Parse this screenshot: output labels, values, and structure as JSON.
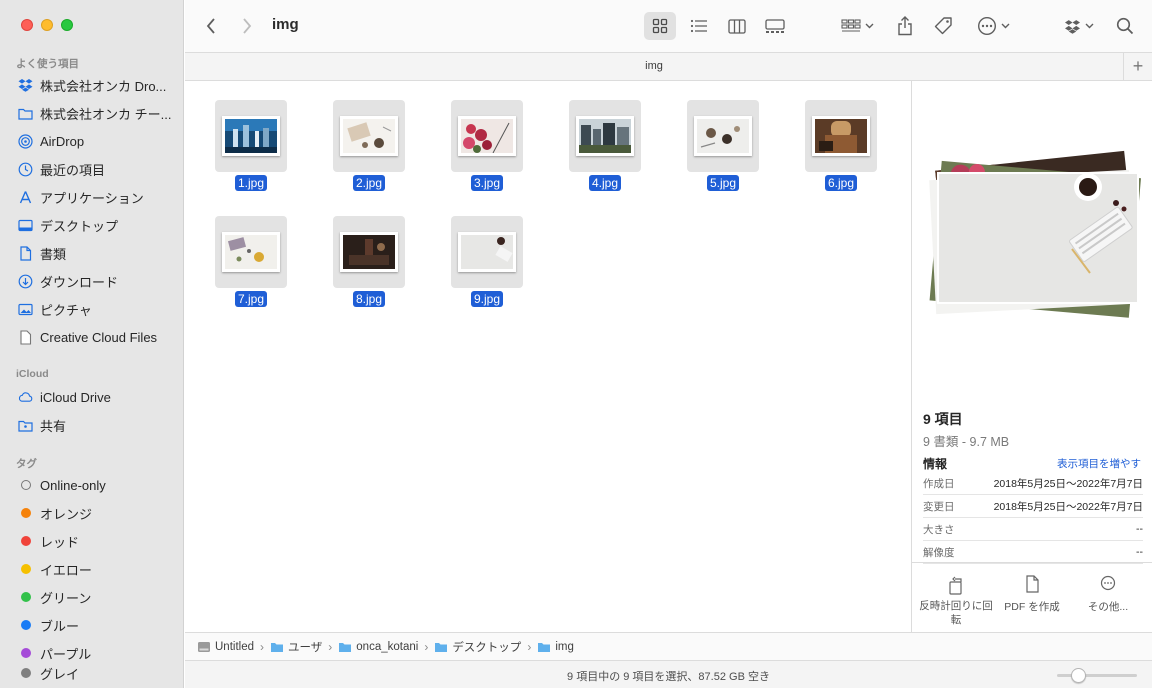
{
  "window": {
    "title": "img"
  },
  "sidebar": {
    "favorites_heading": "よく使う項目",
    "favorites": [
      {
        "label": "株式会社オンカ Dro...",
        "icon": "dropbox-icon"
      },
      {
        "label": "株式会社オンカ チー...",
        "icon": "folder-icon"
      },
      {
        "label": "AirDrop",
        "icon": "airdrop-icon"
      },
      {
        "label": "最近の項目",
        "icon": "clock-icon"
      },
      {
        "label": "アプリケーション",
        "icon": "applications-icon"
      },
      {
        "label": "デスクトップ",
        "icon": "desktop-icon"
      },
      {
        "label": "書類",
        "icon": "document-icon"
      },
      {
        "label": "ダウンロード",
        "icon": "download-icon"
      },
      {
        "label": "ピクチャ",
        "icon": "photo-icon"
      },
      {
        "label": "Creative Cloud Files",
        "icon": "file-icon"
      }
    ],
    "icloud_heading": "iCloud",
    "icloud": [
      {
        "label": "iCloud Drive",
        "icon": "cloud-icon"
      },
      {
        "label": "共有",
        "icon": "shared-folder-icon"
      }
    ],
    "tags_heading": "タグ",
    "tags": [
      {
        "label": "Online-only",
        "color": ""
      },
      {
        "label": "オレンジ",
        "color": "#f5820b"
      },
      {
        "label": "レッド",
        "color": "#f0433a"
      },
      {
        "label": "イエロー",
        "color": "#f5c000"
      },
      {
        "label": "グリーン",
        "color": "#32c14a"
      },
      {
        "label": "ブルー",
        "color": "#1a7cf5"
      },
      {
        "label": "パープル",
        "color": "#a54bd8"
      },
      {
        "label": "グレイ",
        "color": "#7f7f7f"
      }
    ]
  },
  "tab": {
    "label": "img",
    "add": "+"
  },
  "files": [
    {
      "name": "1.jpg"
    },
    {
      "name": "2.jpg"
    },
    {
      "name": "3.jpg"
    },
    {
      "name": "4.jpg"
    },
    {
      "name": "5.jpg"
    },
    {
      "name": "6.jpg"
    },
    {
      "name": "7.jpg"
    },
    {
      "name": "8.jpg"
    },
    {
      "name": "9.jpg"
    }
  ],
  "preview": {
    "title": "9 項目",
    "subtitle": "9 書類 - 9.7 MB",
    "info_label": "情報",
    "show_more": "表示項目を増やす",
    "rows": [
      {
        "key": "作成日",
        "value": "2018年5月25日〜2022年7月7日"
      },
      {
        "key": "変更日",
        "value": "2018年5月25日〜2022年7月7日"
      },
      {
        "key": "大きさ",
        "value": "--"
      },
      {
        "key": "解像度",
        "value": "--"
      }
    ],
    "actions": [
      {
        "label": "反時計回りに回転"
      },
      {
        "label": "PDF を作成"
      },
      {
        "label": "その他..."
      }
    ]
  },
  "pathbar": [
    {
      "label": "Untitled"
    },
    {
      "label": "ユーザ"
    },
    {
      "label": "onca_kotani"
    },
    {
      "label": "デスクトップ"
    },
    {
      "label": "img"
    }
  ],
  "status": {
    "text": "9 項目中の 9 項目を選択、87.52 GB 空き"
  },
  "colors": {
    "accent": "#1f5ed6",
    "sidebar_bg": "#e6e6e6"
  }
}
